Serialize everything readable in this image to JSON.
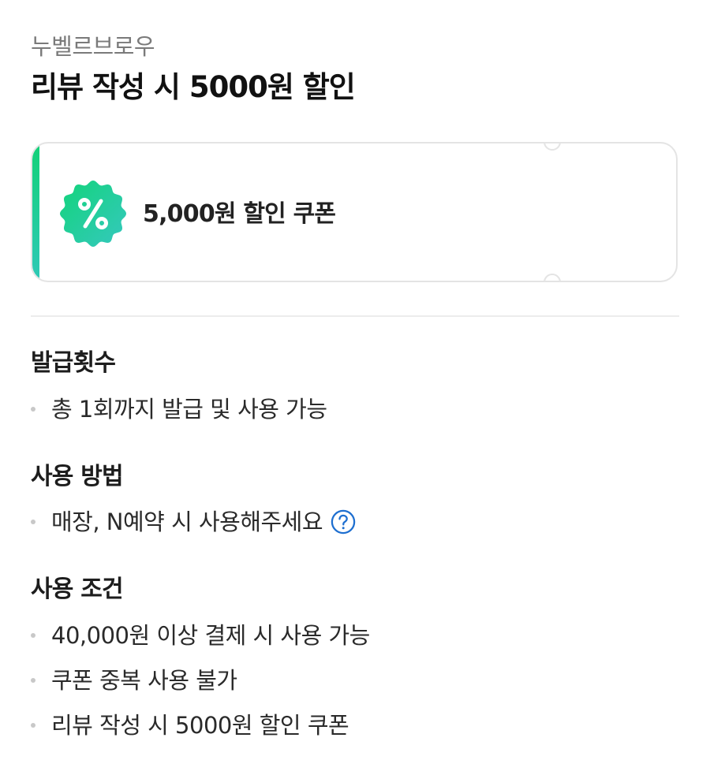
{
  "header": {
    "store_name": "누벨르브로우",
    "title": "리뷰 작성 시 5000원 할인"
  },
  "coupon": {
    "icon": "percent-badge-icon",
    "label": "5,000원 할인 쿠폰",
    "accent_color_start": "#13d178",
    "accent_color_end": "#2ec9b6"
  },
  "sections": {
    "issue": {
      "title": "발급횟수",
      "items": [
        "총 1회까지 발급 및 사용 가능"
      ]
    },
    "usage": {
      "title": "사용 방법",
      "items": [
        "매장, N예약 시 사용해주세요"
      ],
      "help_icon": "question-circle-icon"
    },
    "conditions": {
      "title": "사용 조건",
      "items": [
        "40,000원 이상 결제 시 사용 가능",
        "쿠폰 중복 사용 불가",
        "리뷰 작성 시 5000원 할인 쿠폰"
      ]
    }
  }
}
